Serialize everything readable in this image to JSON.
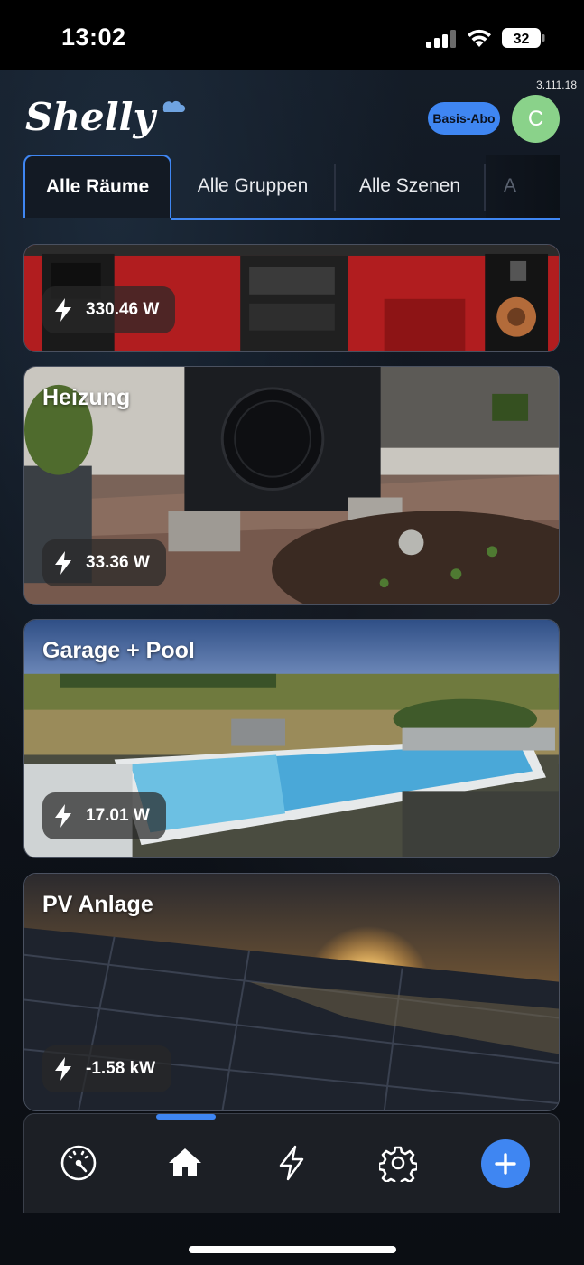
{
  "status_bar": {
    "time": "13:02",
    "battery": "32"
  },
  "app": {
    "version": "3.111.18",
    "subscription_badge": "Basis-Abo",
    "avatar_letter": "C"
  },
  "tabs": [
    {
      "label": "Alle Räume",
      "active": true
    },
    {
      "label": "Alle Gruppen",
      "active": false
    },
    {
      "label": "Alle Szenen",
      "active": false
    },
    {
      "label": "A",
      "active": false
    }
  ],
  "rooms": [
    {
      "name": "",
      "power": "330.46 W"
    },
    {
      "name": "Heizung",
      "power": "33.36 W"
    },
    {
      "name": "Garage + Pool",
      "power": "17.01 W"
    },
    {
      "name": "PV Anlage",
      "power": "-1.58 kW"
    }
  ],
  "bottom_nav": {
    "items": [
      "dashboard-icon",
      "home-icon",
      "energy-icon",
      "settings-icon",
      "add-icon"
    ],
    "active": "home-icon"
  },
  "colors": {
    "accent": "#3f86f2",
    "avatar": "#8ad28a"
  }
}
